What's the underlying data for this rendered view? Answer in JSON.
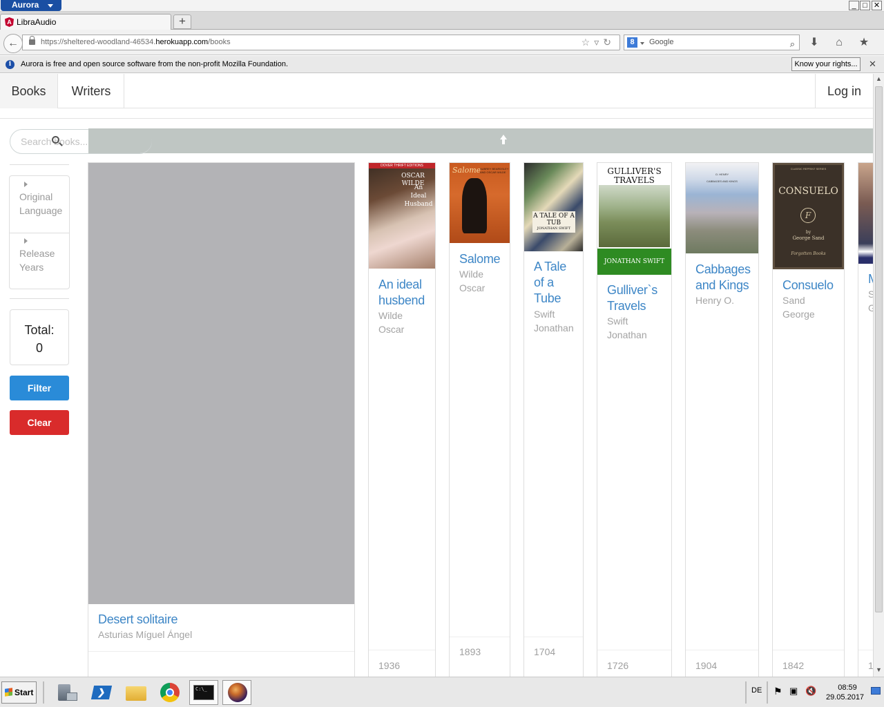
{
  "browser": {
    "app_name": "Aurora",
    "tab_title": "LibraAudio",
    "tab_favicon_letter": "A",
    "new_tab_symbol": "+",
    "url_prefix": "https://sheltered-woodland-46534.",
    "url_host": "herokuapp.com",
    "url_path": "/books",
    "search_engine": "Google",
    "search_engine_letter": "8",
    "notification": "Aurora is free and open source software from the non-profit Mozilla Foundation.",
    "notification_info_glyph": "i",
    "notification_button": "Know your rights...",
    "window_buttons": [
      "_",
      "□",
      "✕"
    ]
  },
  "nav": {
    "books": "Books",
    "writers": "Writers",
    "login": "Log in"
  },
  "search": {
    "placeholder": "Search books..."
  },
  "sidebar": {
    "facets": [
      {
        "label_line1": "Original",
        "label_line2": "Language"
      },
      {
        "label_line1": "Release",
        "label_line2": "Years"
      }
    ],
    "total_label": "Total:",
    "total_value": "0",
    "filter_label": "Filter",
    "clear_label": "Clear"
  },
  "books": [
    {
      "title": "Desert solitaire",
      "author": "Asturias Míguel Ángel",
      "year": ""
    },
    {
      "title_lines": [
        "An ideal",
        "husbend"
      ],
      "author_lines": [
        "Wilde",
        "Oscar"
      ],
      "year": "1936",
      "cover_text": [
        "DOVER THRIFT EDITIONS",
        "OSCAR WILDE",
        "An",
        "Ideal",
        "Husband"
      ]
    },
    {
      "title_lines": [
        "Salome"
      ],
      "author_lines": [
        "Wilde",
        "Oscar"
      ],
      "year": "1893",
      "cover_text": [
        "Salome",
        "AUBREY BEARDSLEY AND OSCAR WILDE"
      ]
    },
    {
      "title_lines": [
        "A Tale",
        "of a",
        "Tube"
      ],
      "author_lines": [
        "Swift",
        "Jonathan"
      ],
      "year": "1704",
      "cover_text": [
        "A TALE OF A TUB",
        "JONATHAN SWIFT"
      ]
    },
    {
      "title_lines": [
        "Gulliver`s",
        "Travels"
      ],
      "author_lines": [
        "Swift",
        "Jonathan"
      ],
      "year": "1726",
      "cover_text": [
        "GULLIVER'S",
        "TRAVELS",
        "JONATHAN SWIFT"
      ]
    },
    {
      "title_lines": [
        "Cabbages",
        "and Kings"
      ],
      "author_lines": [
        "Henry O."
      ],
      "year": "1904",
      "cover_text": [
        "O. HENRY",
        "CABBAGES AND KINGS"
      ]
    },
    {
      "title_lines": [
        "Consuelo"
      ],
      "author_lines": [
        "Sand",
        "George"
      ],
      "year": "1842",
      "cover_text": [
        "CLASSIC REPRINT SERIES",
        "CONSUELO",
        "by",
        "George Sand",
        "Forgotten Books"
      ]
    },
    {
      "title_lines": [
        "M"
      ],
      "author_lines": [
        "S",
        "G"
      ],
      "year": "1"
    }
  ],
  "taskbar": {
    "start_label": "Start",
    "language": "DE",
    "time": "08:59",
    "date": "29.05.2017",
    "console_label": "C:\\_"
  },
  "colors": {
    "link_blue": "#3d86c6",
    "filter_blue": "#2a8bd8",
    "clear_red": "#d92b2b",
    "placeholder_gray": "#b3b3b6"
  }
}
